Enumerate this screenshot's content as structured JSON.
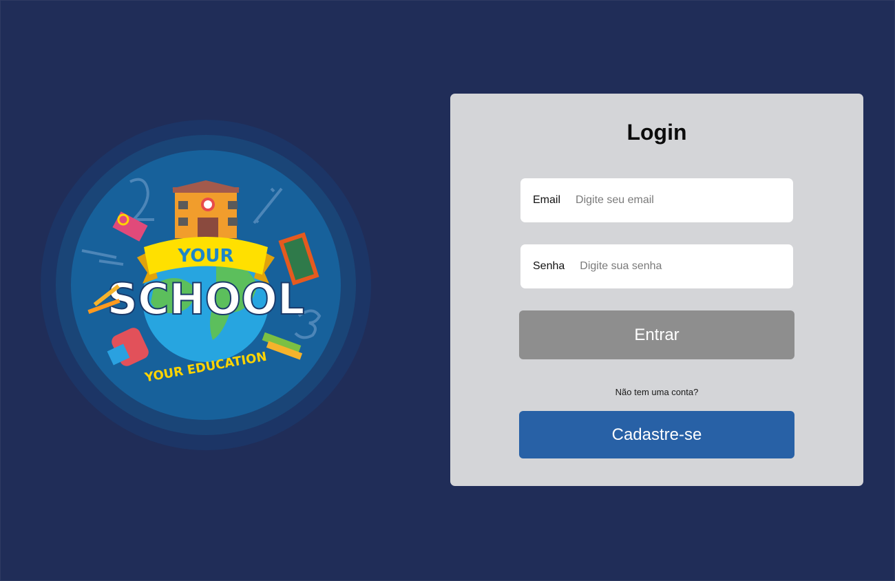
{
  "logo": {
    "top_text": "YOUR",
    "main_text": "SCHOOL",
    "bottom_text": "YOUR EDUCATION"
  },
  "login": {
    "title": "Login",
    "email_label": "Email",
    "email_placeholder": "Digite seu email",
    "password_label": "Senha",
    "password_placeholder": "Digite sua senha",
    "submit_label": "Entrar",
    "no_account_text": "Não tem uma conta?",
    "register_label": "Cadastre-se"
  },
  "colors": {
    "page_background": "#202d58",
    "card_background": "#d4d5d8",
    "submit_button": "#8e8e8e",
    "register_button": "#2861a6"
  }
}
